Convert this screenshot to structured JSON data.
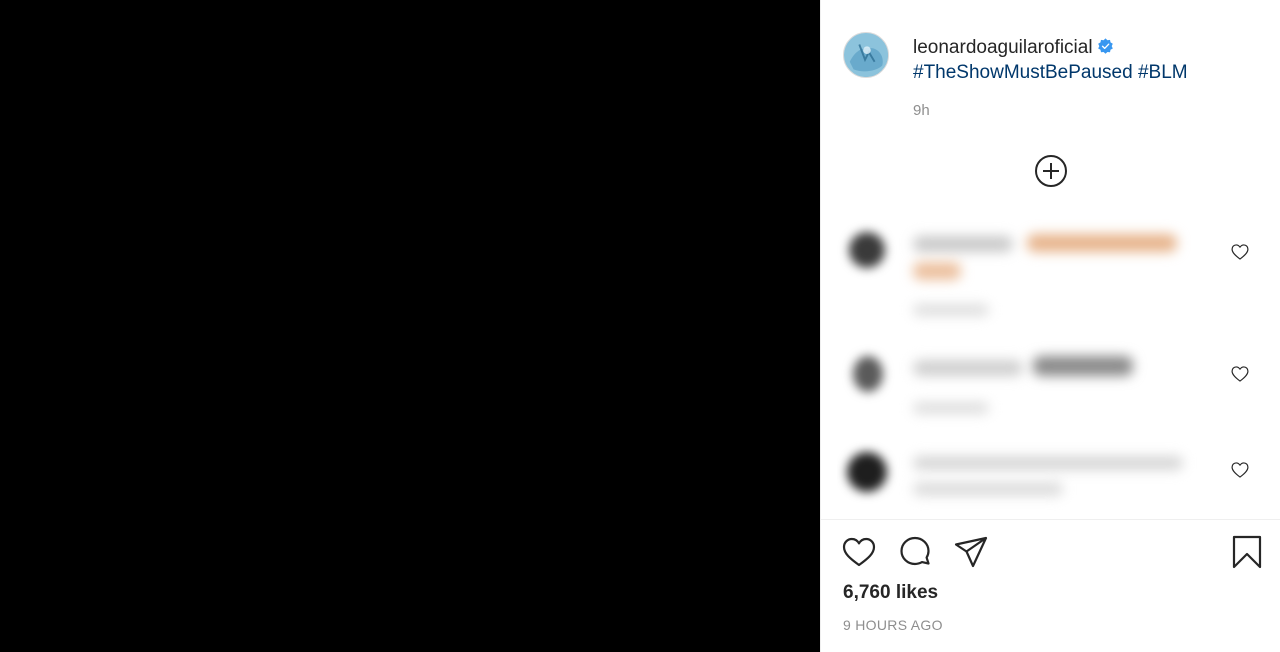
{
  "post": {
    "username": "leonardoaguilaroficial",
    "verified": true,
    "hashtags": [
      "#TheShowMustBePaused",
      "#BLM"
    ],
    "caption_time": "9h",
    "likes": "6,760 likes",
    "time_ago": "9 HOURS AGO"
  },
  "icons": {
    "load_more": "plus-circle-icon",
    "comment_like": "heart-outline-icon",
    "like": "heart-outline-icon",
    "comment": "speech-bubble-icon",
    "share": "paper-plane-icon",
    "save": "bookmark-icon",
    "verified": "verified-badge-icon"
  },
  "colors": {
    "media_background": "#000000",
    "hashtag": "#00376b",
    "verified_badge": "#3897f0",
    "muted_text": "#8e8e8e",
    "primary_text": "#262626"
  }
}
